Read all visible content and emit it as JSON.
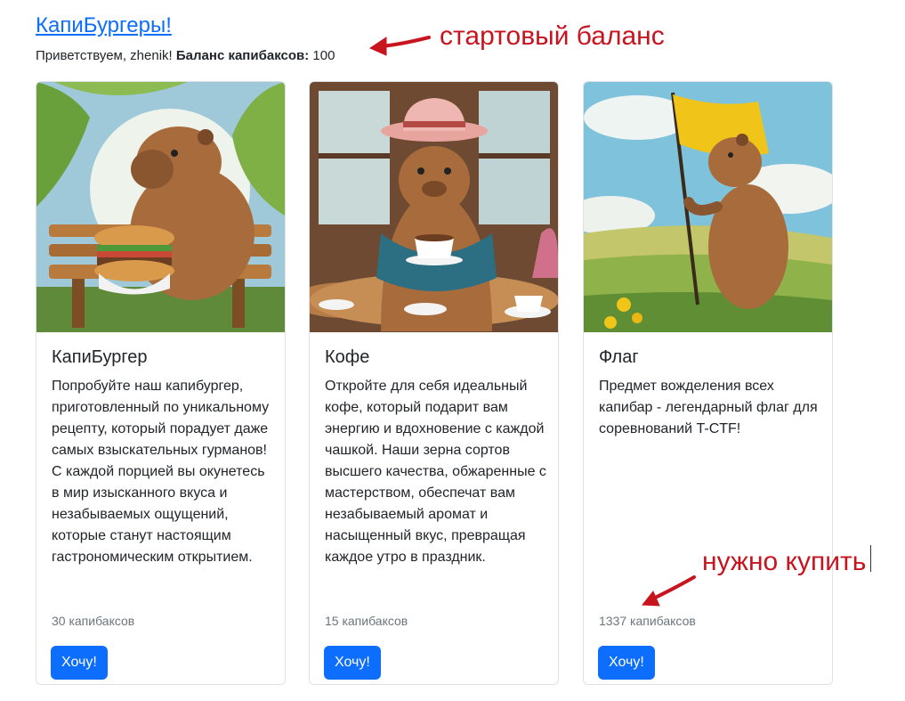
{
  "header": {
    "site_title": "КапиБургеры!",
    "greeting_prefix": "Приветствуем, zhenik!",
    "balance_label": "Баланс капибаксов:",
    "balance_value": "100"
  },
  "products": [
    {
      "title": "КапиБургер",
      "description": "Попробуйте наш капибургер, приготовленный по уникальному рецепту, который порадует даже самых взыскательных гурманов! С каждой порцией вы окунетесь в мир изысканного вкуса и незабываемых ощущений, которые станут настоящим гастрономическим открытием.",
      "price": "30 капибаксов",
      "button_label": "Хочу!"
    },
    {
      "title": "Кофе",
      "description": "Откройте для себя идеальный кофе, который подарит вам энергию и вдохновение с каждой чашкой. Наши зерна сортов высшего качества, обжаренные с мастерством, обеспечат вам незабываемый аромат и насыщенный вкус, превращая каждое утро в праздник.",
      "price": "15 капибаксов",
      "button_label": "Хочу!"
    },
    {
      "title": "Флаг",
      "description": "Предмет вожделения всех капибар - легендарный флаг для соревнований T-CTF!",
      "price": "1337 капибаксов",
      "button_label": "Хочу!"
    }
  ],
  "annotations": {
    "balance_note": "стартовый баланс",
    "buy_note": "нужно купить"
  },
  "colors": {
    "link": "#0d6efd",
    "button": "#0d6efd",
    "annotation": "#c8141e"
  }
}
